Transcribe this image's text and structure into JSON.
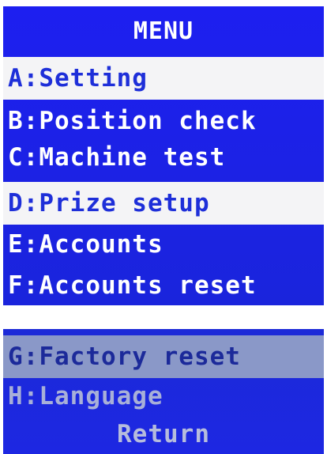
{
  "menu": {
    "title": "MENU",
    "items": [
      {
        "label": "A:Setting"
      },
      {
        "label": "B:Position check"
      },
      {
        "label": "C:Machine test"
      },
      {
        "label": "D:Prize setup"
      },
      {
        "label": "E:Accounts"
      },
      {
        "label": "F:Accounts reset"
      }
    ]
  },
  "menu2": {
    "items": [
      {
        "label": "G:Factory reset"
      },
      {
        "label": "H:Language"
      }
    ],
    "return_label": "Return"
  },
  "colors": {
    "screen_bg": "#1f23e6",
    "highlight_bg": "#f4f4f6",
    "highlight_text": "#1e2fd9"
  }
}
